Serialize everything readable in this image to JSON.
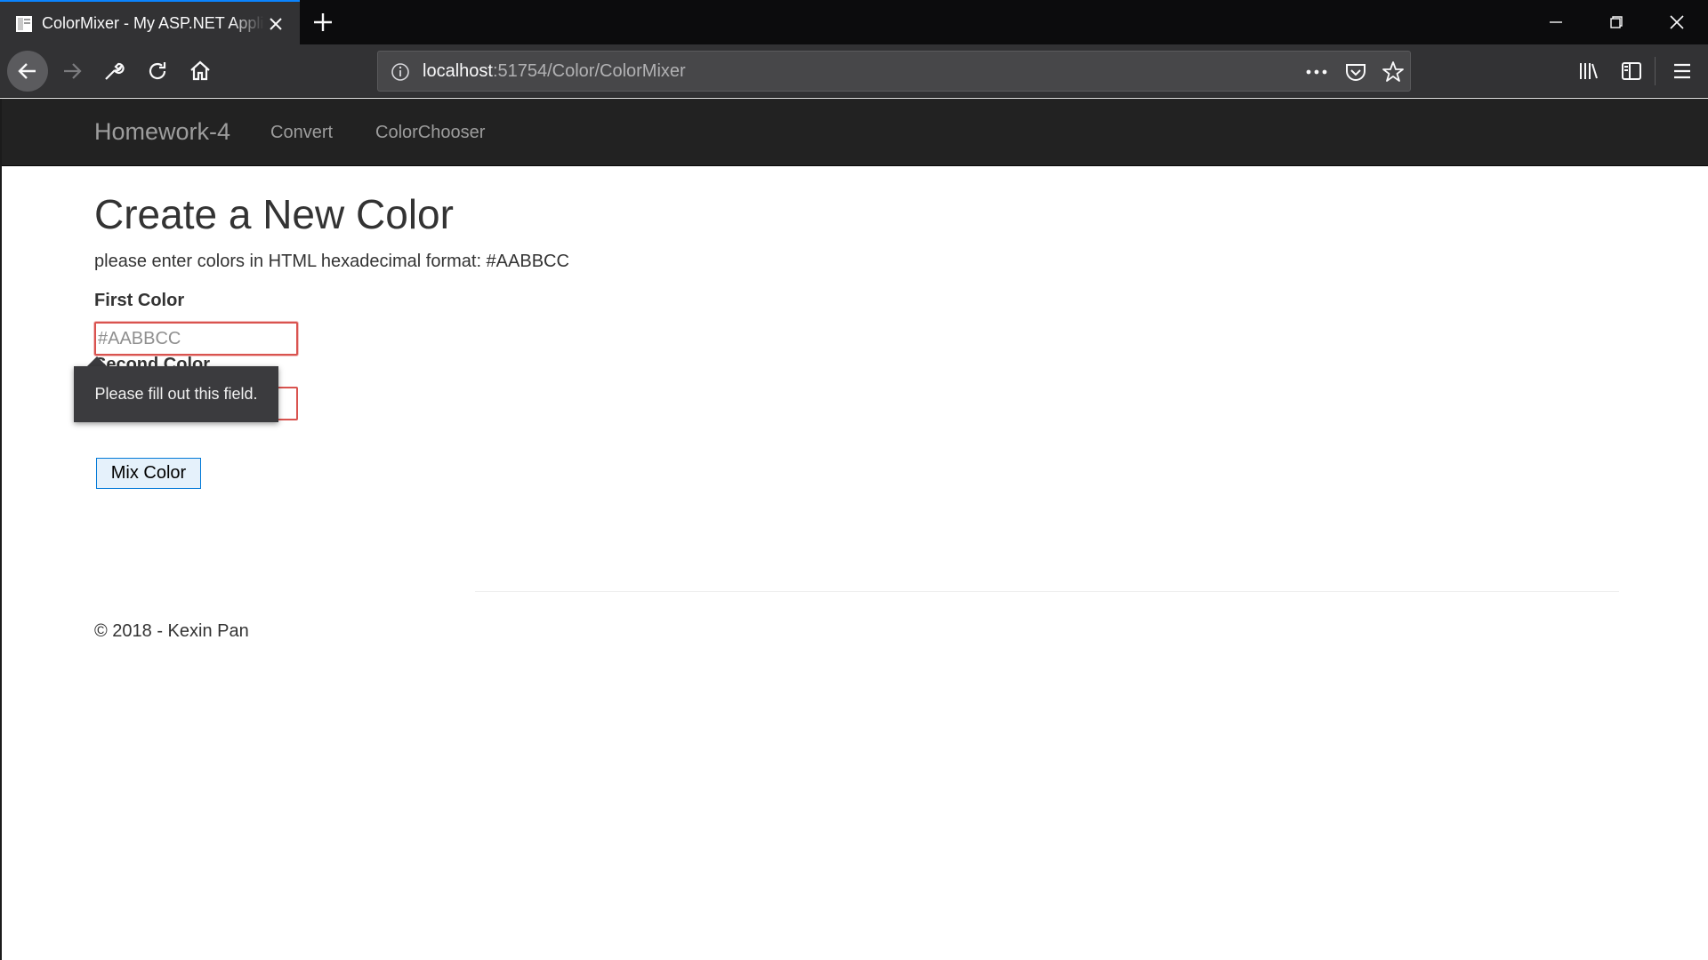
{
  "browser": {
    "tab_title": "ColorMixer - My ASP.NET Application",
    "url_host": "localhost",
    "url_path": ":51754/Color/ColorMixer",
    "accent_color": "#0a84ff"
  },
  "navbar": {
    "brand": "Homework-4",
    "links": [
      {
        "label": "Convert"
      },
      {
        "label": "ColorChooser"
      }
    ]
  },
  "main": {
    "title": "Create a New Color",
    "help_text": "please enter colors in HTML hexadecimal format: #AABBCC",
    "first_color": {
      "label": "First Color",
      "placeholder": "#AABBCC",
      "value": ""
    },
    "second_color": {
      "label": "Second Color",
      "value": ""
    },
    "validation_tooltip": "Please fill out this field.",
    "submit_label": "Mix Color",
    "error_border_color": "#d9534f"
  },
  "footer": {
    "text": "© 2018 - Kexin Pan"
  }
}
